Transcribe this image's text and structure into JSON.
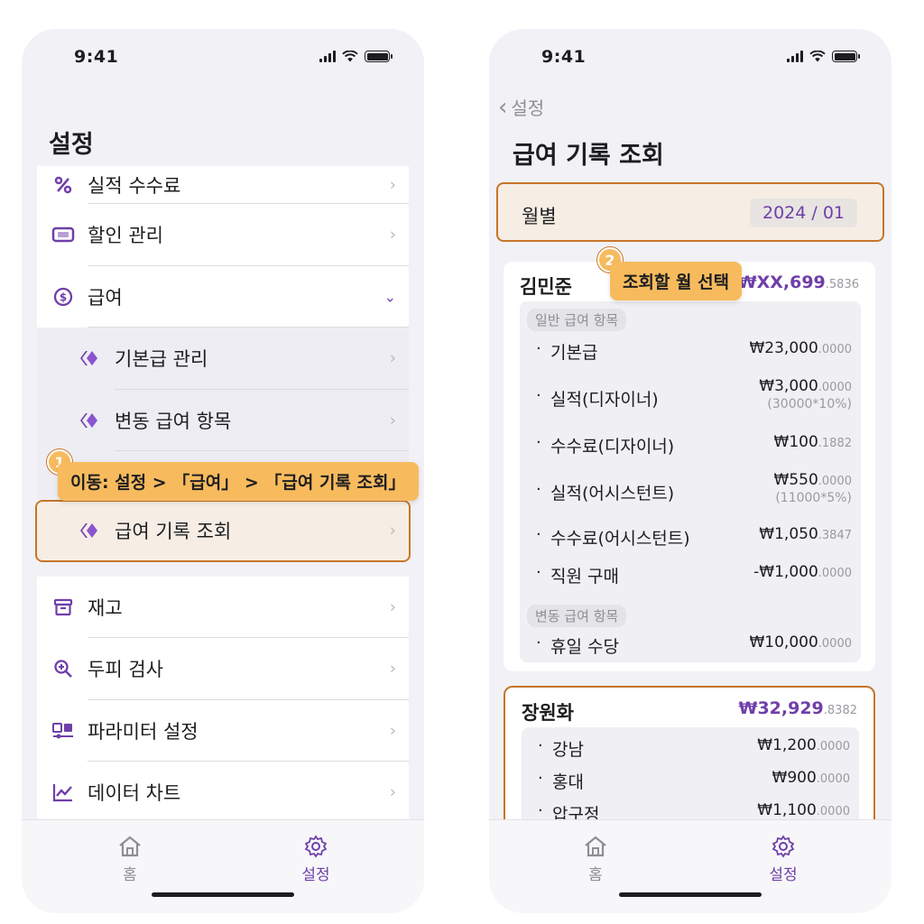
{
  "status": {
    "time": "9:41"
  },
  "left": {
    "title": "설정",
    "rows": [
      {
        "label": "실적 수수료",
        "icon": "percent-icon"
      },
      {
        "label": "할인 관리",
        "icon": "ticket-icon"
      },
      {
        "label": "급여",
        "icon": "payroll-icon"
      },
      {
        "label": "기본급 관리",
        "icon": "diamond-icon"
      },
      {
        "label": "변동 급여 항목",
        "icon": "diamond-icon"
      },
      {
        "label": "급여 기록 조회",
        "icon": "diamond-icon"
      },
      {
        "label": "재고",
        "icon": "archive-icon"
      },
      {
        "label": "두피 검사",
        "icon": "zoom-icon"
      },
      {
        "label": "파라미터 설정",
        "icon": "params-icon"
      },
      {
        "label": "데이터 차트",
        "icon": "chart-icon"
      }
    ],
    "step_badge": "1",
    "tooltip": "이동: 설정 > 「급여」 > 「급여 기록 조회」"
  },
  "right": {
    "back_label": "설정",
    "title": "급여 기록 조회",
    "month_label": "월별",
    "month_value": "2024 / 01",
    "step_badge": "2",
    "tooltip": "조회할 월 선택",
    "employees": [
      {
        "name": "김민준",
        "total": "₩XX,699",
        "total_dec": ".5836",
        "groups": [
          {
            "tag": "일반 급여 항목",
            "items": [
              {
                "name": "기본급",
                "amount": "₩23,000",
                "dec": ".0000",
                "note": ""
              },
              {
                "name": "실적(디자이너)",
                "amount": "₩3,000",
                "dec": ".0000",
                "note": "(30000*10%)"
              },
              {
                "name": "수수료(디자이너)",
                "amount": "₩100",
                "dec": ".1882",
                "note": ""
              },
              {
                "name": "실적(어시스턴트)",
                "amount": "₩550",
                "dec": ".0000",
                "note": "(11000*5%)"
              },
              {
                "name": "수수료(어시스턴트)",
                "amount": "₩1,050",
                "dec": ".3847",
                "note": ""
              },
              {
                "name": "직원 구매",
                "amount": "-₩1,000",
                "dec": ".0000",
                "note": ""
              }
            ]
          },
          {
            "tag": "변동 급여 항목",
            "items": [
              {
                "name": "휴일 수당",
                "amount": "₩10,000",
                "dec": ".0000",
                "note": ""
              }
            ]
          }
        ]
      },
      {
        "name": "장원화",
        "total": "₩32,929",
        "total_dec": ".8382",
        "groups": [
          {
            "items": [
              {
                "name": "강남",
                "amount": "₩1,200",
                "dec": ".0000"
              },
              {
                "name": "홍대",
                "amount": "₩900",
                "dec": ".0000"
              },
              {
                "name": "압구정",
                "amount": "₩1,100",
                "dec": ".0000"
              }
            ]
          }
        ]
      }
    ]
  },
  "tabbar": {
    "home": "홈",
    "settings": "설정"
  },
  "colors": {
    "accent": "#6f3fa9",
    "highlight_border": "#c8742a",
    "tooltip": "#f7bb5e"
  }
}
